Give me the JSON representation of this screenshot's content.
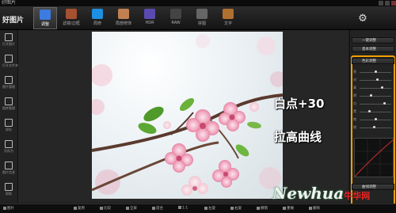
{
  "window": {
    "title": "好图片"
  },
  "topbar": {
    "logo": "好图片",
    "tools": [
      {
        "label": "调整",
        "icon": "adjust-icon",
        "color": "#3d7be0",
        "active": true
      },
      {
        "label": "滤镜/边框",
        "icon": "filter-brush-icon",
        "color": "#a55030",
        "active": false
      },
      {
        "label": "局修",
        "icon": "drop-icon",
        "color": "#1e8ee0",
        "active": false
      },
      {
        "label": "局部修饰",
        "icon": "retouch-icon",
        "color": "#c08050",
        "active": false
      },
      {
        "label": "HDR",
        "icon": "hdr-icon",
        "color": "#5a4ab0",
        "active": false
      },
      {
        "label": "RAW",
        "icon": "raw-icon",
        "color": "#444",
        "active": false
      },
      {
        "label": "拼图",
        "icon": "collage-icon",
        "color": "#666",
        "active": false
      },
      {
        "label": "文字",
        "icon": "text-icon",
        "color": "#b07030",
        "active": false
      }
    ]
  },
  "leftbar": {
    "items": [
      {
        "label": "打开图片",
        "icon": "open-folder-icon"
      },
      {
        "label": "打开文件夹",
        "icon": "folder-icon"
      },
      {
        "label": "图片管理",
        "icon": "browse-icon"
      },
      {
        "label": "图库管理",
        "icon": "library-icon"
      },
      {
        "label": "保存",
        "icon": "save-icon"
      },
      {
        "label": "另存为",
        "icon": "save-as-icon"
      },
      {
        "label": "图片信息",
        "icon": "info-icon"
      },
      {
        "label": "帮助",
        "icon": "help-icon"
      }
    ]
  },
  "rightpanel": {
    "buttons": [
      {
        "label": "一键调整"
      },
      {
        "label": "基本调整"
      },
      {
        "label": "色彩调整"
      }
    ],
    "sliders": [
      {
        "label": "亮",
        "value": 0.5
      },
      {
        "label": "对",
        "value": 0.55
      },
      {
        "label": "高",
        "value": 0.7
      },
      {
        "label": "阴",
        "value": 0.35
      },
      {
        "label": "白",
        "value": 0.8
      },
      {
        "label": "黑",
        "value": 0.3
      },
      {
        "label": "饱",
        "value": 0.5
      },
      {
        "label": "锐",
        "value": 0.45
      }
    ],
    "bottom_button": "曲线调整"
  },
  "annotation": {
    "line1": "白点+30",
    "line2": "拉高曲线"
  },
  "statusbar": {
    "items": [
      "图片",
      "复原",
      "比较",
      "全屏",
      "适合",
      "1:1",
      "左旋",
      "右旋",
      "撤销",
      "重做",
      "删除"
    ]
  },
  "watermark": {
    "text": "Newhua",
    "cn": "牛华网"
  }
}
